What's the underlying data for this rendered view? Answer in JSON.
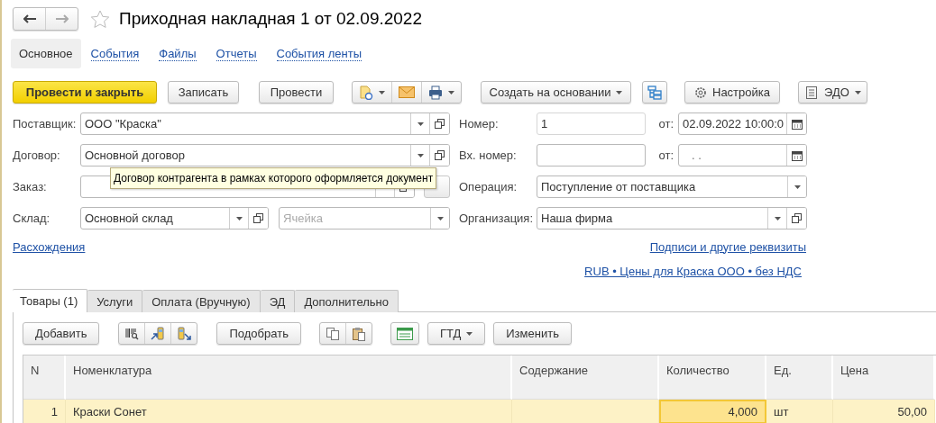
{
  "title": "Приходная накладная 1 от 02.09.2022",
  "favorite": false,
  "sections": [
    {
      "label": "Основное",
      "selected": true
    },
    {
      "label": "События",
      "selected": false
    },
    {
      "label": "Файлы",
      "selected": false
    },
    {
      "label": "Отчеты",
      "selected": false
    },
    {
      "label": "События ленты",
      "selected": false
    }
  ],
  "commands": {
    "post_and_close": {
      "label": "Провести и закрыть",
      "default": true
    },
    "save": {
      "label": "Записать",
      "default": false
    },
    "post": {
      "label": "Провести",
      "default": false
    },
    "create_based_on": {
      "label": "Создать на основании"
    },
    "settings": {
      "label": "Настройка"
    },
    "edo": {
      "label": "ЭДО"
    }
  },
  "form": {
    "supplier": {
      "label": "Поставщик:",
      "value": "ООО \"Краска\""
    },
    "contract": {
      "label": "Договор:",
      "value": "Основной договор"
    },
    "order": {
      "label": "Заказ:"
    },
    "warehouse": {
      "label": "Склад:",
      "value": "Основной склад"
    },
    "cell": {
      "placeholder": "Ячейка"
    },
    "number": {
      "label": "Номер:",
      "value": "1",
      "date_label": "от:",
      "date": "02.09.2022 10:00:0"
    },
    "incoming_number": {
      "label": "Вх. номер:",
      "date_label": "от:",
      "date": ".  ."
    },
    "operation": {
      "label": "Операция:",
      "value": "Поступление от поставщика"
    },
    "organization": {
      "label": "Организация:",
      "value": "Наша фирма"
    }
  },
  "tooltip": "Договор контрагента в рамках которого оформляется документ",
  "links": {
    "discrepancies": "Расхождения",
    "signatures": "Подписи и другие реквизиты",
    "prices": "RUB • Цены для Краска ООО • без НДС"
  },
  "tabs": [
    {
      "label": "Товары (1)",
      "selected": true
    },
    {
      "label": "Услуги",
      "selected": false
    },
    {
      "label": "Оплата (Вручную)",
      "selected": false
    },
    {
      "label": "ЭД",
      "selected": false
    },
    {
      "label": "Дополнительно",
      "selected": false
    }
  ],
  "table_toolbar": {
    "add": "Добавить",
    "pick": "Подобрать",
    "gtd": "ГТД",
    "edit": "Изменить"
  },
  "table": {
    "columns": [
      {
        "label": "N",
        "kind": "number"
      },
      {
        "label": "Номенклатура",
        "kind": "text"
      },
      {
        "label": "Содержание",
        "kind": "text"
      },
      {
        "label": "Количество",
        "kind": "number"
      },
      {
        "label": "Ед.",
        "kind": "text"
      },
      {
        "label": "Цена",
        "kind": "number"
      }
    ],
    "rows": [
      {
        "selected": true,
        "cells": [
          {
            "text": "1",
            "focused": false
          },
          {
            "text": "Краски Сонет",
            "focused": false
          },
          {
            "focused": false
          },
          {
            "text": "4,000",
            "focused": true
          },
          {
            "text": "шт",
            "focused": false
          },
          {
            "text": "50,00",
            "focused": false
          }
        ]
      }
    ]
  }
}
